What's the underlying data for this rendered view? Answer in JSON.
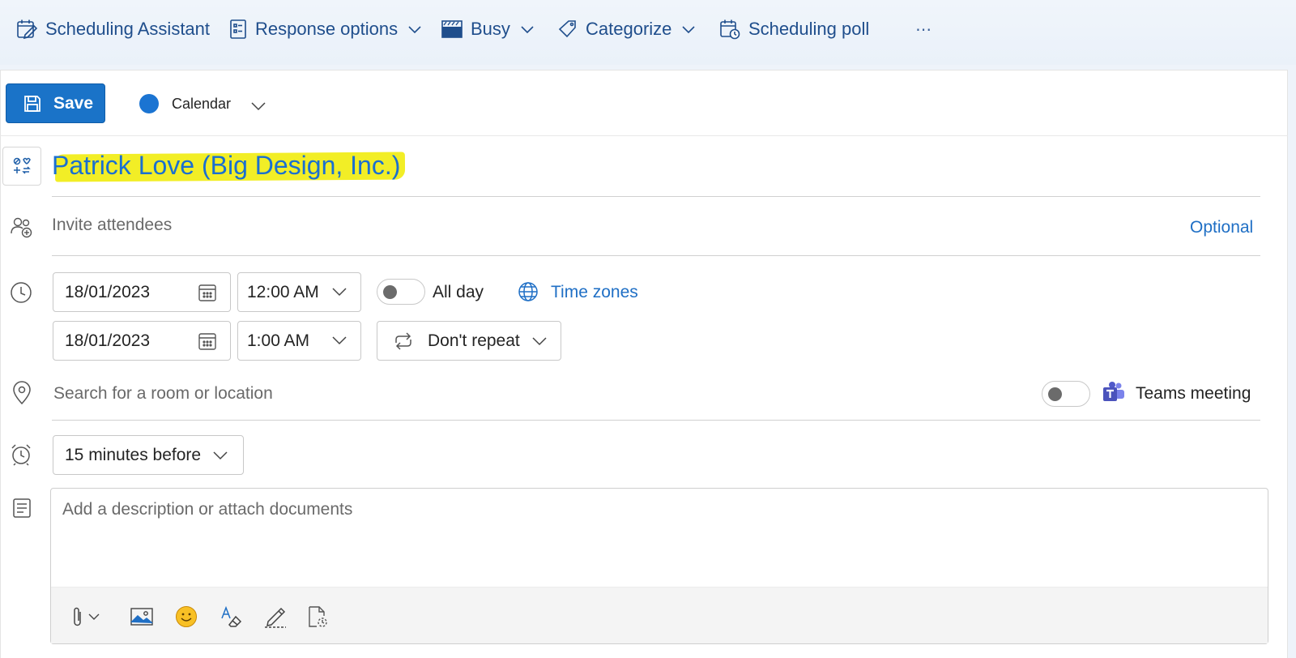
{
  "ribbon": {
    "scheduling_assistant": "Scheduling Assistant",
    "response_options": "Response options",
    "busy": "Busy",
    "categorize": "Categorize",
    "scheduling_poll": "Scheduling poll",
    "more": "⋯"
  },
  "toolbar": {
    "save_label": "Save",
    "calendar_label": "Calendar",
    "calendar_color": "#1b74d2"
  },
  "event": {
    "title": "Patrick Love (Big Design, Inc.)",
    "attendees_placeholder": "Invite attendees",
    "optional_label": "Optional",
    "start_date": "18/01/2023",
    "start_time": "12:00 AM",
    "end_date": "18/01/2023",
    "end_time": "1:00 AM",
    "all_day_label": "All day",
    "time_zones_label": "Time zones",
    "repeat_label": "Don't repeat",
    "location_placeholder": "Search for a room or location",
    "teams_label": "Teams meeting",
    "reminder_label": "15 minutes before",
    "description_placeholder": "Add a description or attach documents"
  },
  "colors": {
    "accent": "#1a73c8",
    "title_highlight": "#f2ee26",
    "link": "#1f6fc5"
  },
  "icons": [
    "scheduling-assistant-icon",
    "response-options-icon",
    "busy-icon",
    "categorize-icon",
    "scheduling-poll-icon",
    "save-icon",
    "title-icon",
    "attendees-icon",
    "clock-icon",
    "calendar-icon",
    "globe-icon",
    "repeat-icon",
    "location-icon",
    "teams-icon",
    "alarm-icon",
    "description-icon",
    "attach-icon",
    "image-icon",
    "emoji-icon",
    "format-icon",
    "signature-icon",
    "loop-icon"
  ]
}
